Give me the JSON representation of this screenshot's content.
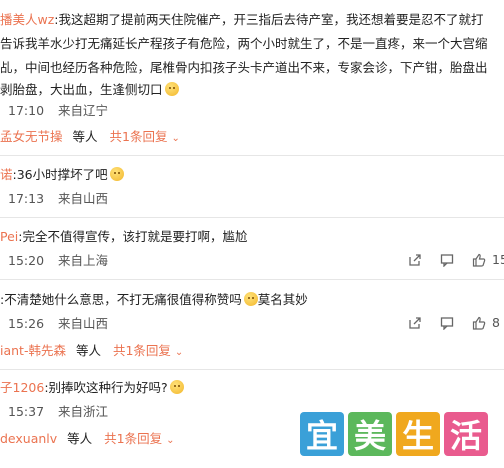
{
  "comments": [
    {
      "lines": [
        {
          "user": "播美人wz",
          "text": ":我这超期了提前两天住院催产，开三指后去待产室，我还想着要是忍不了就打"
        },
        {
          "text": "告诉我羊水少打无痛延长产程孩子有危险，两个小时就生了，不是一直疼，来一个大宫缩"
        },
        {
          "text": "乩，中间也经历各种危险，尾椎骨内扣孩子头卡产道出不来，专家会诊，下产钳，胎盘出"
        },
        {
          "text": "剥胎盘，大出血，生逢侧切口"
        }
      ],
      "time": "17:10",
      "location": "来自辽宁"
    },
    {
      "reply_summary": {
        "users": "孟女无节操",
        "suffix": "等人",
        "link": "共1条回复"
      }
    },
    {
      "user": "诺",
      "text": ":36小时撑坏了吧",
      "time": "17:13",
      "location": "来自山西"
    },
    {
      "user": "Pei",
      "text": ":完全不值得宣传，该打就是要打啊，尴尬",
      "time": "15:20",
      "location": "来自上海",
      "like_count": "15"
    },
    {
      "text": ":不清楚她什么意思，不打无痛很值得称赞吗",
      "text_after_emoji": "莫名其妙",
      "time": "15:26",
      "location": "来自山西",
      "like_count": "8"
    },
    {
      "reply_summary": {
        "users": "iant-韩先森",
        "suffix": "等人",
        "link": "共1条回复"
      }
    },
    {
      "user": "子1206",
      "text": ":别捧吹这种行为好吗?",
      "time": "15:37",
      "location": "来自浙江"
    },
    {
      "reply_summary": {
        "users": "dexuanlv",
        "suffix": "等人",
        "link": "共1条回复"
      }
    }
  ],
  "watermark": {
    "chars": [
      "宜",
      "美",
      "生",
      "活"
    ],
    "colors": [
      "#3aa0d8",
      "#5cb85c",
      "#f0a81e",
      "#e95b8e"
    ]
  },
  "colors": {
    "username": "#eb7350",
    "meta": "#555555"
  }
}
